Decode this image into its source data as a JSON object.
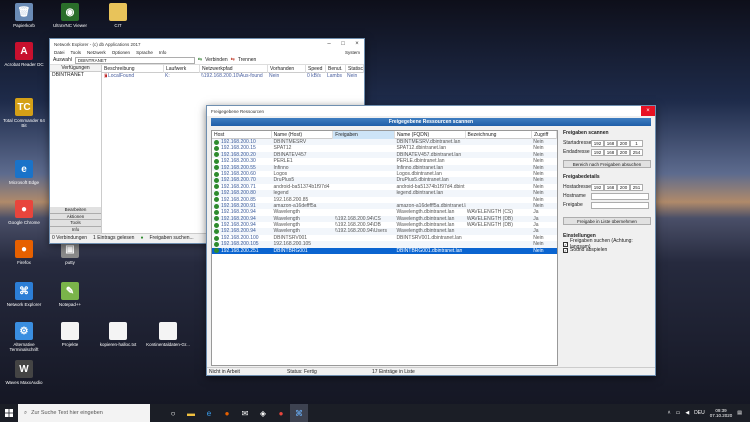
{
  "desktop_icons": [
    {
      "label": "Papierkorb",
      "glyph": "🗑",
      "color": "#6a8bb5",
      "icon": "recycle-bin-icon"
    },
    {
      "label": "UltraVNC Viewer",
      "glyph": "◉",
      "color": "#2a6e2a",
      "icon": "vnc-icon"
    },
    {
      "label": "CIT",
      "glyph": "",
      "color": "#e8c35a",
      "icon": "folder-icon"
    },
    {
      "label": "Acrobat Reader DC",
      "glyph": "A",
      "color": "#c8102e",
      "icon": "acrobat-icon"
    },
    {
      "label": "Total Commander 64 Bit",
      "glyph": "TC",
      "color": "#d4a017",
      "icon": "total-commander-icon"
    },
    {
      "label": "Microsoft Edge",
      "glyph": "e",
      "color": "#1a73c9",
      "icon": "edge-icon"
    },
    {
      "label": "Google Chrome",
      "glyph": "●",
      "color": "#e8453c",
      "icon": "chrome-icon"
    },
    {
      "label": "Firefox",
      "glyph": "●",
      "color": "#e66000",
      "icon": "firefox-icon"
    },
    {
      "label": "putty",
      "glyph": "▣",
      "color": "#8a8a8a",
      "icon": "putty-icon"
    },
    {
      "label": "Network Explorer",
      "glyph": "⌘",
      "color": "#2c7ed6",
      "icon": "network-explorer-icon"
    },
    {
      "label": "Notepad++",
      "glyph": "✎",
      "color": "#7ab44a",
      "icon": "notepad-icon"
    },
    {
      "label": "Alternative Terminalschrift",
      "glyph": "⚙",
      "color": "#3a8ee0",
      "icon": "settings-icon"
    },
    {
      "label": "Projekte",
      "glyph": "",
      "color": "#f4f4f4",
      "icon": "document-icon"
    },
    {
      "label": "kopieren-halloc.txt",
      "glyph": "",
      "color": "#f4f4f4",
      "icon": "text-file-icon"
    },
    {
      "label": "Kontinentaldaten-Gr...",
      "glyph": "",
      "color": "#f4f4f4",
      "icon": "text-file-icon"
    },
    {
      "label": "Waves MaxxAudio",
      "glyph": "W",
      "color": "#444",
      "icon": "waves-icon"
    }
  ],
  "ne": {
    "title": "Network Explorer - (c) db Applications 2017",
    "menu": [
      "Datei",
      "Tools",
      "Netzwerk",
      "Optionen",
      "Sprache",
      "Info"
    ],
    "system": "System",
    "toolbar": {
      "label": "Auswahl",
      "value": "DBINTRANET",
      "connect": "Verbinden",
      "disconnect": "Trennen"
    },
    "sidebar_tab": "Verfügungen",
    "sidebar_item": "DBINTRANET",
    "side_buttons": [
      "Bearbeiten",
      "Aktionen",
      "Tools",
      "Info"
    ],
    "headers": [
      "Beschreibung",
      "Laufwerk",
      "Netzwerkpfad",
      "Vorhanden",
      "Speed",
      "Benut.",
      "Statisch"
    ],
    "row": [
      "LocalFound",
      "K:",
      "\\\\192.168.200.10\\Aus-found",
      "Nein",
      "0 kB/s",
      "Lambs",
      "Nein"
    ],
    "status": [
      "0 Verbindungen",
      "1 Eintrags gelesen",
      "Freigaben suchen..."
    ]
  },
  "dlg": {
    "title": "Freigegebene Ressourcen",
    "banner": "Freigegebene Ressourcen scannen",
    "headers": [
      "Host",
      "Name (Host)",
      "Freigaben",
      "Name (FQDN)",
      "Bezeichnung",
      "Zugriff"
    ],
    "rows": [
      [
        "192.168.200.10",
        "DBINTMESRV",
        "",
        "DBINTMESRV.dbintranet.lan",
        "",
        "Nein"
      ],
      [
        "192.168.200.15",
        "SPAT12",
        "",
        "SPAT12.dbintranet.lan",
        "",
        "Nein"
      ],
      [
        "192.168.200.20",
        "DBINATEV457",
        "",
        "DBINATEV457.dbintranet.lan",
        "",
        "Nein"
      ],
      [
        "192.168.200.30",
        "PERLE1",
        "",
        "PERLE.dbintranet.lan",
        "",
        "Nein"
      ],
      [
        "192.168.200.55",
        "Infinno",
        "",
        "Infinno.dbintranet.lan",
        "",
        "Nein"
      ],
      [
        "192.168.200.60",
        "Logos",
        "",
        "Logos.dbintranet.lan",
        "",
        "Nein"
      ],
      [
        "192.168.200.70",
        "DruPlus5",
        "",
        "DruPlus5.dbintranet.lan",
        "",
        "Nein"
      ],
      [
        "192.168.200.71",
        "android-ba51374b1f97d4",
        "",
        "android-ba51374b1f97d4.dbint",
        "",
        "Nein"
      ],
      [
        "192.168.200.80",
        "legend",
        "",
        "legend.dbintranet.lan",
        "",
        "Nein"
      ],
      [
        "192.168.200.85",
        "192.168.200.85",
        "",
        "",
        "",
        "Nein"
      ],
      [
        "192.168.200.91",
        "amazon-a16defff5a",
        "",
        "amazon-a16defff5a.dbintranet.lan",
        "",
        "Nein"
      ],
      [
        "192.168.200.94",
        "Wavelength",
        "",
        "Wavelength.dbintranet.lan",
        "WAVELENGTH (CS)",
        "Ja"
      ],
      [
        "192.168.200.94",
        "Wavelength",
        "\\\\192.168.200.94\\CS",
        "Wavelength.dbintranet.lan",
        "WAVELENGTH (DB)",
        "Ja"
      ],
      [
        "192.168.200.94",
        "Wavelength",
        "\\\\192.168.200.94\\DB",
        "Wavelength.dbintranet.lan",
        "WAVELENGTH (DB)",
        "Ja"
      ],
      [
        "192.168.200.94",
        "Wavelength",
        "\\\\192.168.200.94\\Users",
        "Wavelength.dbintranet.lan",
        "",
        "Ja"
      ],
      [
        "192.168.200.100",
        "DBINTSRV001",
        "",
        "DBINTSRV001.dbintranet.lan",
        "",
        "Nein"
      ],
      [
        "192.168.200.105",
        "192.168.200.105",
        "",
        "",
        "",
        "Nein"
      ],
      [
        "192.168.200.251",
        "DBINTBRG001",
        "",
        "DBINTBRG001.dbintranet.lan",
        "",
        "Nein"
      ]
    ],
    "selected_index": 17,
    "scan_title": "Freigaben scannen",
    "start_label": "Startadresse",
    "end_label": "Endadresse",
    "start_ip": [
      "192",
      "168",
      "200",
      "1"
    ],
    "end_ip": [
      "192",
      "168",
      "200",
      "254"
    ],
    "scan_button": "Bereich nach Freigaben absuchen",
    "details_title": "Freigabedetails",
    "hostaddr_label": "Hostadresse",
    "hostaddr_ip": [
      "192",
      "168",
      "200",
      "251"
    ],
    "hostname_label": "Hostname",
    "share_label": "Freigabe",
    "transfer_button": "Freigabe in Liste übernehmen",
    "settings_title": "Einstellungen",
    "cb1": "Freigaben suchen (Achtung: langsam)",
    "cb2": "Sound abspielen",
    "status": [
      "Nicht in Arbeit",
      "Status: Fertig",
      "17 Einträge in Liste"
    ]
  },
  "taskbar": {
    "search_placeholder": "Zur Suche Text hier eingeben",
    "lang": "DEU",
    "time": "09:39",
    "date": "07.10.2020"
  }
}
